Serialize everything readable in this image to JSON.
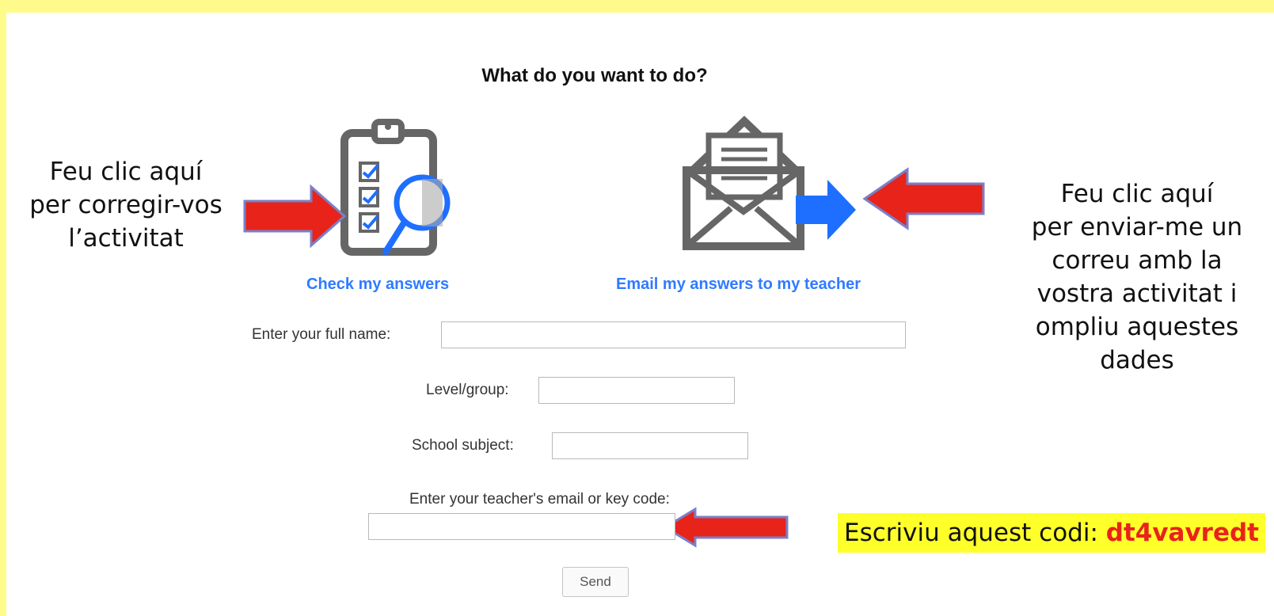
{
  "heading": "What do you want to do?",
  "actions": {
    "check_label": "Check my answers",
    "email_label": "Email my answers to my teacher"
  },
  "annotations": {
    "left_note": [
      "Feu clic aquí",
      "per corregir-vos",
      "l’activitat"
    ],
    "right_note": [
      "Feu clic aquí",
      "per enviar-me un",
      "correu amb la",
      "vostra activitat i",
      "ompliu aquestes",
      "dades"
    ],
    "code_prefix": "Escriviu aquest codi: ",
    "code_value": "dt4vavredt"
  },
  "form": {
    "full_name_label": "Enter your full name:",
    "full_name_value": "",
    "level_label": "Level/group:",
    "level_value": "",
    "subject_label": "School subject:",
    "subject_value": "",
    "teacher_label": "Enter your teacher's email or key code:",
    "teacher_value": "",
    "send_label": "Send"
  },
  "colors": {
    "background": "#fffb8a",
    "link": "#2f7bff",
    "arrow_red": "#e8231a",
    "arrow_blue": "#1e6fff",
    "icon_gray": "#666666",
    "code_highlight": "#ffff2a"
  }
}
